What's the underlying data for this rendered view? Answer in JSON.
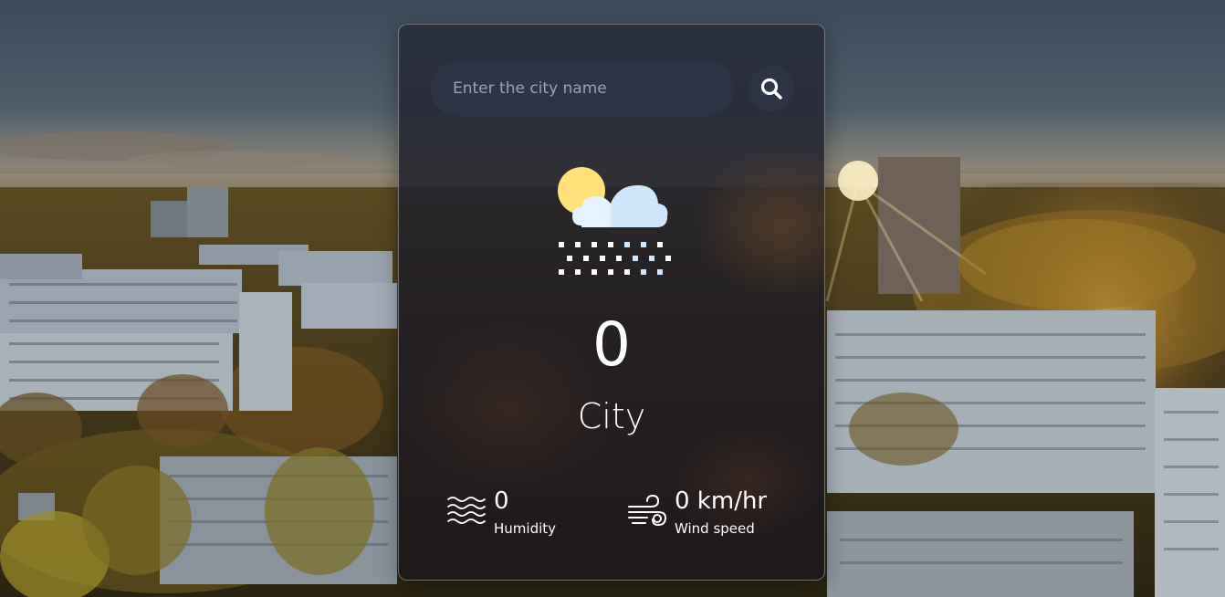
{
  "search": {
    "placeholder": "Enter the city name",
    "value": ""
  },
  "weather": {
    "icon": "snow-cloud-sun-icon",
    "temperature": "0",
    "city": "City"
  },
  "details": {
    "humidity": {
      "value": "0",
      "label": "Humidity",
      "icon": "humidity-waves-icon"
    },
    "wind": {
      "value": "0 km/hr",
      "label": "Wind speed",
      "icon": "wind-icon"
    }
  },
  "colors": {
    "card_bg": "#2c2b36",
    "input_bg": "#2c3446",
    "text": "#ffffff",
    "placeholder": "#9aa3b3",
    "sun": "#ffe27a",
    "cloud": "#e6f2ff"
  }
}
